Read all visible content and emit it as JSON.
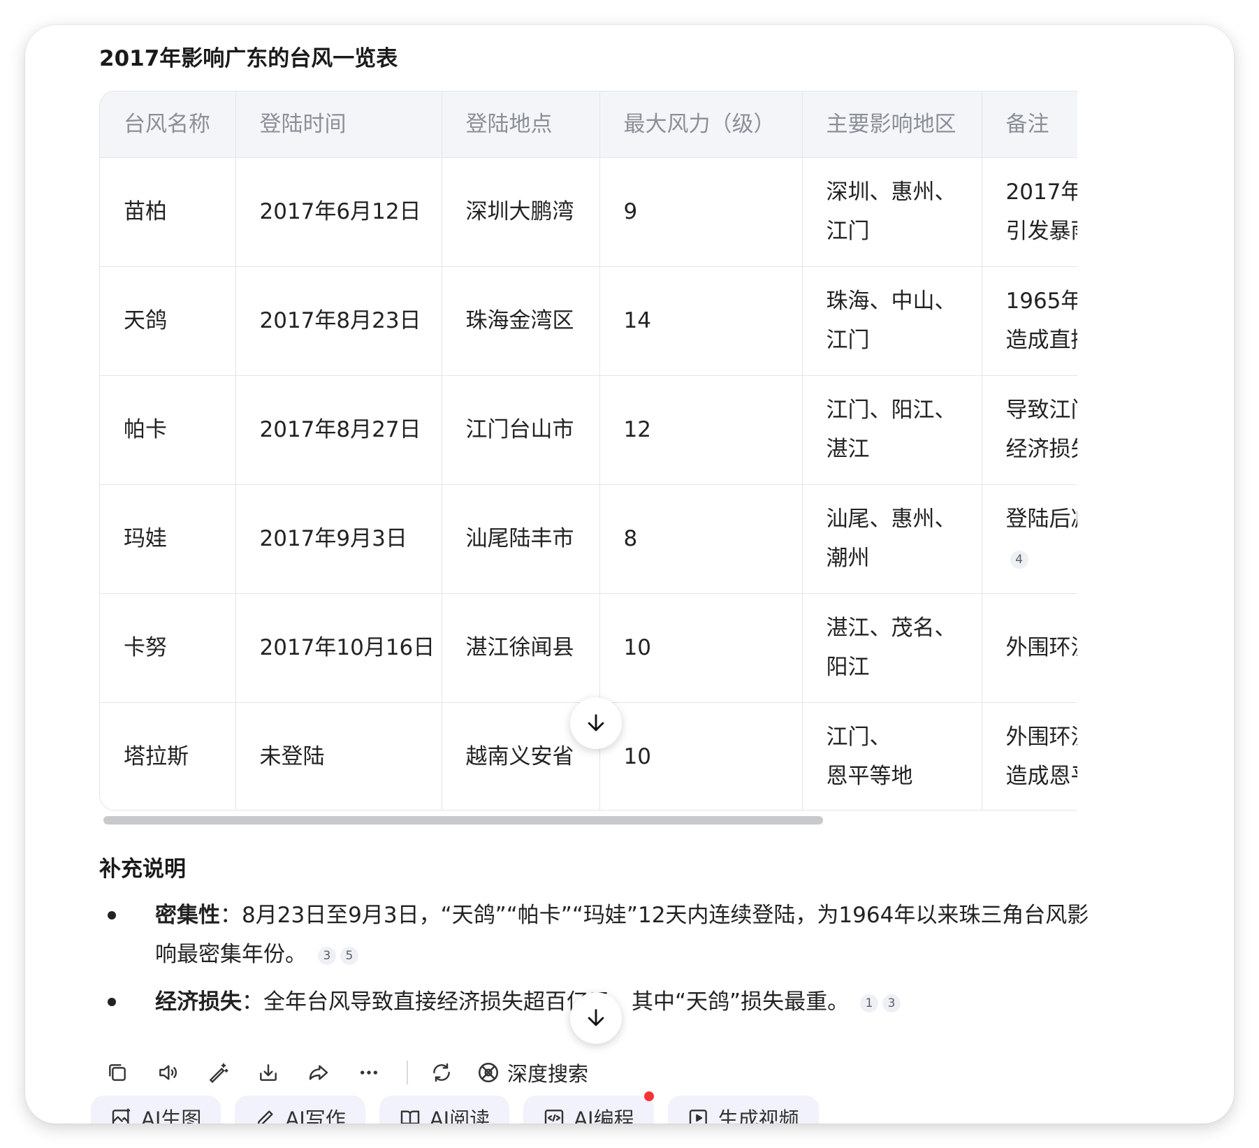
{
  "title": "2017年影响广东的台风一览表",
  "table": {
    "headers": [
      "台风名称",
      "登陆时间",
      "登陆地点",
      "最大风力（级）",
      "主要影响地区",
      "备注"
    ],
    "rows": [
      {
        "name": "苗柏",
        "time": "2017年6月12日",
        "place": "深圳大鹏湾",
        "wind": "9",
        "region_1": "深圳、惠州、",
        "region_2": "江门",
        "note_1": "2017年",
        "note_2": "引发暴雨",
        "cite": ""
      },
      {
        "name": "天鸽",
        "time": "2017年8月23日",
        "place": "珠海金湾区",
        "wind": "14",
        "region_1": "珠海、中山、",
        "region_2": "江门",
        "note_1": "1965年",
        "note_2": "造成直接",
        "cite": ""
      },
      {
        "name": "帕卡",
        "time": "2017年8月27日",
        "place": "江门台山市",
        "wind": "12",
        "region_1": "江门、阳江、",
        "region_2": "湛江",
        "note_1": "导致江门",
        "note_2": "经济损失",
        "cite": ""
      },
      {
        "name": "玛娃",
        "time": "2017年9月3日",
        "place": "汕尾陆丰市",
        "wind": "8",
        "region_1": "汕尾、惠州、",
        "region_2": "潮州",
        "note_1": "登陆后减",
        "note_2": "",
        "cite": "4"
      },
      {
        "name": "卡努",
        "time": "2017年10月16日",
        "place": "湛江徐闻县",
        "wind": "10",
        "region_1": "湛江、茂名、",
        "region_2": "阳江",
        "note_1": "外围环流",
        "note_2": "",
        "cite": ""
      },
      {
        "name": "塔拉斯",
        "time": "未登陆",
        "place": "越南义安省",
        "wind": "10",
        "region_1": "江门、",
        "region_2": "恩平等地",
        "note_1": "外围环流",
        "note_2": "造成恩平",
        "cite": ""
      }
    ]
  },
  "supplement": {
    "title": "补充说明",
    "items": [
      {
        "label": "密集性",
        "sep": "：",
        "text": "8月23日至9月3日，“天鸽”“帕卡”“玛娃”12天内连续登陆，为1964年以来珠三角台风影响最密集年份。",
        "cites": [
          "3",
          "5"
        ]
      },
      {
        "label": "经济损失",
        "sep": "：",
        "text": "全年台风导致直接经济损失超百亿元，其中“天鸽”损失最重。",
        "cites": [
          "1",
          "3"
        ]
      }
    ]
  },
  "toolbar": {
    "icons": [
      "copy-icon",
      "speaker-icon",
      "edit-wand-icon",
      "download-icon",
      "share-icon",
      "more-icon",
      "refresh-icon"
    ],
    "deep_search": "深度搜索"
  },
  "chips": [
    {
      "label": "AI生图",
      "icon": "image-gen-icon",
      "dot": false
    },
    {
      "label": "AI写作",
      "icon": "pen-icon",
      "dot": false
    },
    {
      "label": "AI阅读",
      "icon": "book-icon",
      "dot": false
    },
    {
      "label": "AI编程",
      "icon": "code-icon",
      "dot": true
    },
    {
      "label": "生成视频",
      "icon": "video-icon",
      "dot": false
    }
  ]
}
